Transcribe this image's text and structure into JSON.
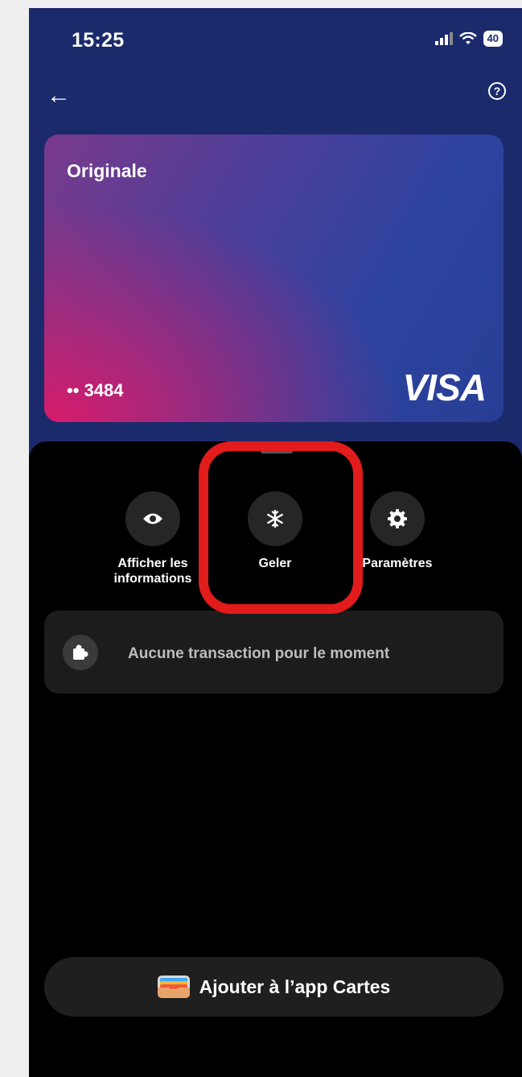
{
  "status": {
    "time": "15:25",
    "battery": "40"
  },
  "card": {
    "name": "Originale",
    "last_digits": "•• 3484",
    "brand": "VISA"
  },
  "actions": [
    {
      "label": "Afficher les informations",
      "icon": "eye-icon"
    },
    {
      "label": "Geler",
      "icon": "snowflake-icon"
    },
    {
      "label": "Paramètres",
      "icon": "gear-icon"
    }
  ],
  "transactions": {
    "empty_text": "Aucune transaction pour le moment",
    "icon": "puzzle-icon"
  },
  "wallet": {
    "label": "Ajouter à l’app Cartes",
    "icon": "wallet-icon"
  },
  "colors": {
    "header_bg": "#1b2a6b",
    "annotation": "#e21b1b"
  }
}
